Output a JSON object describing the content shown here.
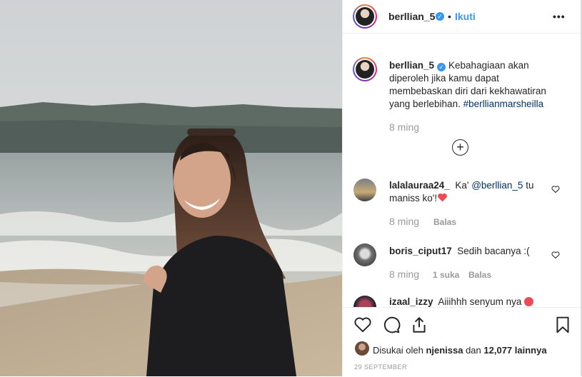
{
  "post": {
    "username": "berllian_5",
    "follow_label": "Ikuti",
    "separator": "•",
    "more_label": "•••",
    "caption": {
      "username": "berllian_5",
      "text": "Kebahagiaan akan diperoleh jika kamu dapat membebaskan diri dari kekhawatiran yang berlebihan. ",
      "hashtag": "#berllianmarsheilla",
      "time": "8 ming"
    },
    "load_more_icon": "plus-circle-icon"
  },
  "comments": [
    {
      "username": "lalalauraa24_",
      "text_before": "Ka' ",
      "mention": "@berllian_5",
      "text_after": " tu maniss ko'!",
      "emoji": "red-heart",
      "time": "8 ming",
      "likes": "",
      "reply_label": "Balas"
    },
    {
      "username": "boris_ciput17",
      "text": "Sedih bacanya :(",
      "time": "8 ming",
      "likes": "1 suka",
      "reply_label": "Balas"
    },
    {
      "username": "izaal_izzy",
      "text": "Aiiihhh senyum nya ",
      "emoji": "heart-eyes"
    }
  ],
  "actions": {
    "icons": [
      "heart-icon",
      "comment-icon",
      "share-icon",
      "bookmark-icon"
    ]
  },
  "likes": {
    "prefix": "Disukai oleh ",
    "user": "njenissa",
    "middle": " dan ",
    "count": "12,077 lainnya"
  },
  "date": "29 SEPTEMBER",
  "colors": {
    "link": "#3897f0",
    "hashtag": "#003569",
    "muted": "#999999",
    "heart": "#ed4956"
  }
}
